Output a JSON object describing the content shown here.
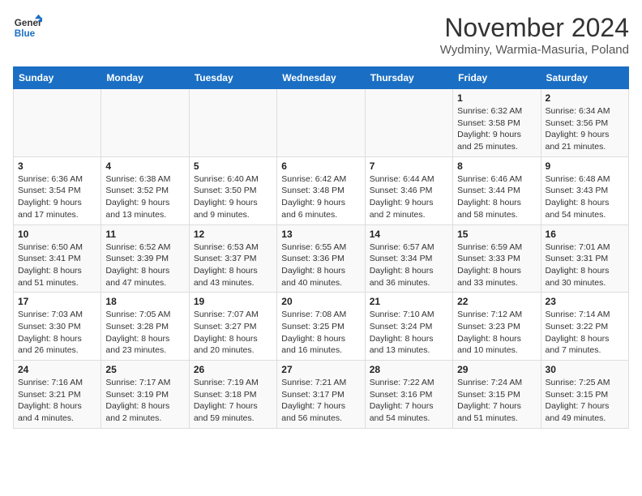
{
  "logo": {
    "line1": "General",
    "line2": "Blue"
  },
  "title": "November 2024",
  "subtitle": "Wydminy, Warmia-Masuria, Poland",
  "days_of_week": [
    "Sunday",
    "Monday",
    "Tuesday",
    "Wednesday",
    "Thursday",
    "Friday",
    "Saturday"
  ],
  "weeks": [
    [
      {
        "day": "",
        "info": ""
      },
      {
        "day": "",
        "info": ""
      },
      {
        "day": "",
        "info": ""
      },
      {
        "day": "",
        "info": ""
      },
      {
        "day": "",
        "info": ""
      },
      {
        "day": "1",
        "info": "Sunrise: 6:32 AM\nSunset: 3:58 PM\nDaylight: 9 hours and 25 minutes."
      },
      {
        "day": "2",
        "info": "Sunrise: 6:34 AM\nSunset: 3:56 PM\nDaylight: 9 hours and 21 minutes."
      }
    ],
    [
      {
        "day": "3",
        "info": "Sunrise: 6:36 AM\nSunset: 3:54 PM\nDaylight: 9 hours and 17 minutes."
      },
      {
        "day": "4",
        "info": "Sunrise: 6:38 AM\nSunset: 3:52 PM\nDaylight: 9 hours and 13 minutes."
      },
      {
        "day": "5",
        "info": "Sunrise: 6:40 AM\nSunset: 3:50 PM\nDaylight: 9 hours and 9 minutes."
      },
      {
        "day": "6",
        "info": "Sunrise: 6:42 AM\nSunset: 3:48 PM\nDaylight: 9 hours and 6 minutes."
      },
      {
        "day": "7",
        "info": "Sunrise: 6:44 AM\nSunset: 3:46 PM\nDaylight: 9 hours and 2 minutes."
      },
      {
        "day": "8",
        "info": "Sunrise: 6:46 AM\nSunset: 3:44 PM\nDaylight: 8 hours and 58 minutes."
      },
      {
        "day": "9",
        "info": "Sunrise: 6:48 AM\nSunset: 3:43 PM\nDaylight: 8 hours and 54 minutes."
      }
    ],
    [
      {
        "day": "10",
        "info": "Sunrise: 6:50 AM\nSunset: 3:41 PM\nDaylight: 8 hours and 51 minutes."
      },
      {
        "day": "11",
        "info": "Sunrise: 6:52 AM\nSunset: 3:39 PM\nDaylight: 8 hours and 47 minutes."
      },
      {
        "day": "12",
        "info": "Sunrise: 6:53 AM\nSunset: 3:37 PM\nDaylight: 8 hours and 43 minutes."
      },
      {
        "day": "13",
        "info": "Sunrise: 6:55 AM\nSunset: 3:36 PM\nDaylight: 8 hours and 40 minutes."
      },
      {
        "day": "14",
        "info": "Sunrise: 6:57 AM\nSunset: 3:34 PM\nDaylight: 8 hours and 36 minutes."
      },
      {
        "day": "15",
        "info": "Sunrise: 6:59 AM\nSunset: 3:33 PM\nDaylight: 8 hours and 33 minutes."
      },
      {
        "day": "16",
        "info": "Sunrise: 7:01 AM\nSunset: 3:31 PM\nDaylight: 8 hours and 30 minutes."
      }
    ],
    [
      {
        "day": "17",
        "info": "Sunrise: 7:03 AM\nSunset: 3:30 PM\nDaylight: 8 hours and 26 minutes."
      },
      {
        "day": "18",
        "info": "Sunrise: 7:05 AM\nSunset: 3:28 PM\nDaylight: 8 hours and 23 minutes."
      },
      {
        "day": "19",
        "info": "Sunrise: 7:07 AM\nSunset: 3:27 PM\nDaylight: 8 hours and 20 minutes."
      },
      {
        "day": "20",
        "info": "Sunrise: 7:08 AM\nSunset: 3:25 PM\nDaylight: 8 hours and 16 minutes."
      },
      {
        "day": "21",
        "info": "Sunrise: 7:10 AM\nSunset: 3:24 PM\nDaylight: 8 hours and 13 minutes."
      },
      {
        "day": "22",
        "info": "Sunrise: 7:12 AM\nSunset: 3:23 PM\nDaylight: 8 hours and 10 minutes."
      },
      {
        "day": "23",
        "info": "Sunrise: 7:14 AM\nSunset: 3:22 PM\nDaylight: 8 hours and 7 minutes."
      }
    ],
    [
      {
        "day": "24",
        "info": "Sunrise: 7:16 AM\nSunset: 3:21 PM\nDaylight: 8 hours and 4 minutes."
      },
      {
        "day": "25",
        "info": "Sunrise: 7:17 AM\nSunset: 3:19 PM\nDaylight: 8 hours and 2 minutes."
      },
      {
        "day": "26",
        "info": "Sunrise: 7:19 AM\nSunset: 3:18 PM\nDaylight: 7 hours and 59 minutes."
      },
      {
        "day": "27",
        "info": "Sunrise: 7:21 AM\nSunset: 3:17 PM\nDaylight: 7 hours and 56 minutes."
      },
      {
        "day": "28",
        "info": "Sunrise: 7:22 AM\nSunset: 3:16 PM\nDaylight: 7 hours and 54 minutes."
      },
      {
        "day": "29",
        "info": "Sunrise: 7:24 AM\nSunset: 3:15 PM\nDaylight: 7 hours and 51 minutes."
      },
      {
        "day": "30",
        "info": "Sunrise: 7:25 AM\nSunset: 3:15 PM\nDaylight: 7 hours and 49 minutes."
      }
    ]
  ]
}
